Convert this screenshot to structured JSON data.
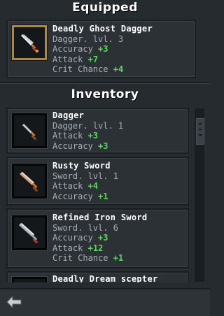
{
  "equipped": {
    "title": "Equipped",
    "item": {
      "icon": "dagger-icon",
      "name": "Deadly Ghost Dagger",
      "type": "Dagger. lvl. 3",
      "stats": [
        {
          "label": "Accuracy",
          "value": "+3"
        },
        {
          "label": "Attack",
          "value": "+7"
        },
        {
          "label": "Crit Chance",
          "value": "+4"
        }
      ]
    }
  },
  "inventory": {
    "title": "Inventory",
    "items": [
      {
        "icon": "dagger-icon",
        "name": "Dagger",
        "type": "Dagger. lvl. 1",
        "stats": [
          {
            "label": "Attack",
            "value": "+3"
          },
          {
            "label": "Accuracy",
            "value": "+3"
          }
        ]
      },
      {
        "icon": "sword-icon",
        "name": "Rusty Sword",
        "type": "Sword. lvl. 1",
        "stats": [
          {
            "label": "Attack",
            "value": "+4"
          },
          {
            "label": "Accuracy",
            "value": "+1"
          }
        ]
      },
      {
        "icon": "sword-icon",
        "name": "Refined Iron Sword",
        "type": "Sword. lvl. 6",
        "stats": [
          {
            "label": "Accuracy",
            "value": "+3"
          },
          {
            "label": "Attack",
            "value": "+12"
          },
          {
            "label": "Crit Chance",
            "value": "+1"
          }
        ]
      },
      {
        "icon": "scepter-icon",
        "name": "Deadly Dream scepter"
      }
    ]
  },
  "nav": {
    "back_icon": "back-arrow-icon"
  },
  "colors": {
    "bonus": "#5fd45f",
    "equipped_frame": "#a8874a",
    "panel": "#2c3136"
  }
}
